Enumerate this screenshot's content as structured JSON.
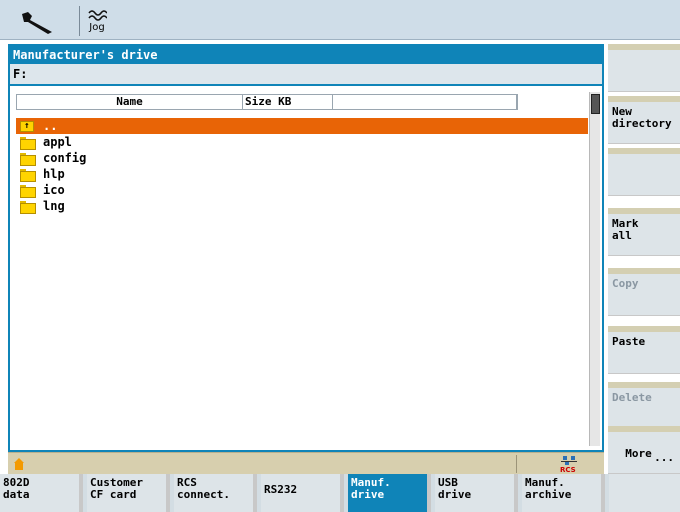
{
  "topbar": {
    "tool_icon": "wrench-icon",
    "jog_icon": "jog-wave-icon",
    "jog_label": "Jog"
  },
  "window": {
    "title": "Manufacturer's drive",
    "path": "F:",
    "columns": [
      "Name",
      "Size KB",
      ""
    ],
    "rows": [
      {
        "name": "..",
        "icon": "folder-up-icon",
        "selected": true
      },
      {
        "name": "appl",
        "icon": "folder-icon",
        "selected": false
      },
      {
        "name": "config",
        "icon": "folder-icon",
        "selected": false
      },
      {
        "name": "hlp",
        "icon": "folder-icon",
        "selected": false
      },
      {
        "name": "ico",
        "icon": "folder-icon",
        "selected": false
      },
      {
        "name": "lng",
        "icon": "folder-icon",
        "selected": false
      }
    ]
  },
  "status": {
    "home_icon": "home-icon",
    "rcs_icon": "rcs-network-icon",
    "rcs_label": "RCS"
  },
  "right_softkeys": [
    {
      "label": "",
      "enabled": true
    },
    {
      "label": "New\ndirectory",
      "enabled": true
    },
    {
      "label": "",
      "enabled": true
    },
    {
      "label": "Mark\nall",
      "enabled": true
    },
    {
      "label": "Copy",
      "enabled": false
    },
    {
      "label": "Paste",
      "enabled": true
    },
    {
      "label": "Delete",
      "enabled": false
    },
    {
      "label": "More",
      "more_indicator": "...",
      "enabled": true
    }
  ],
  "bottom_softkeys": [
    {
      "label": "802D\ndata",
      "active": false
    },
    {
      "label": "Customer\nCF card",
      "active": false
    },
    {
      "label": "RCS\nconnect.",
      "active": false
    },
    {
      "label": "RS232",
      "active": false
    },
    {
      "label": "Manuf.\ndrive",
      "active": true
    },
    {
      "label": "USB\ndrive",
      "active": false
    },
    {
      "label": "Manuf.\narchive",
      "active": false
    },
    {
      "label": "",
      "active": false
    }
  ],
  "colors": {
    "accent_blue": "#0f84b8",
    "selection_orange": "#e86406",
    "folder_yellow": "#ffd400",
    "status_tan": "#d7cfae"
  }
}
